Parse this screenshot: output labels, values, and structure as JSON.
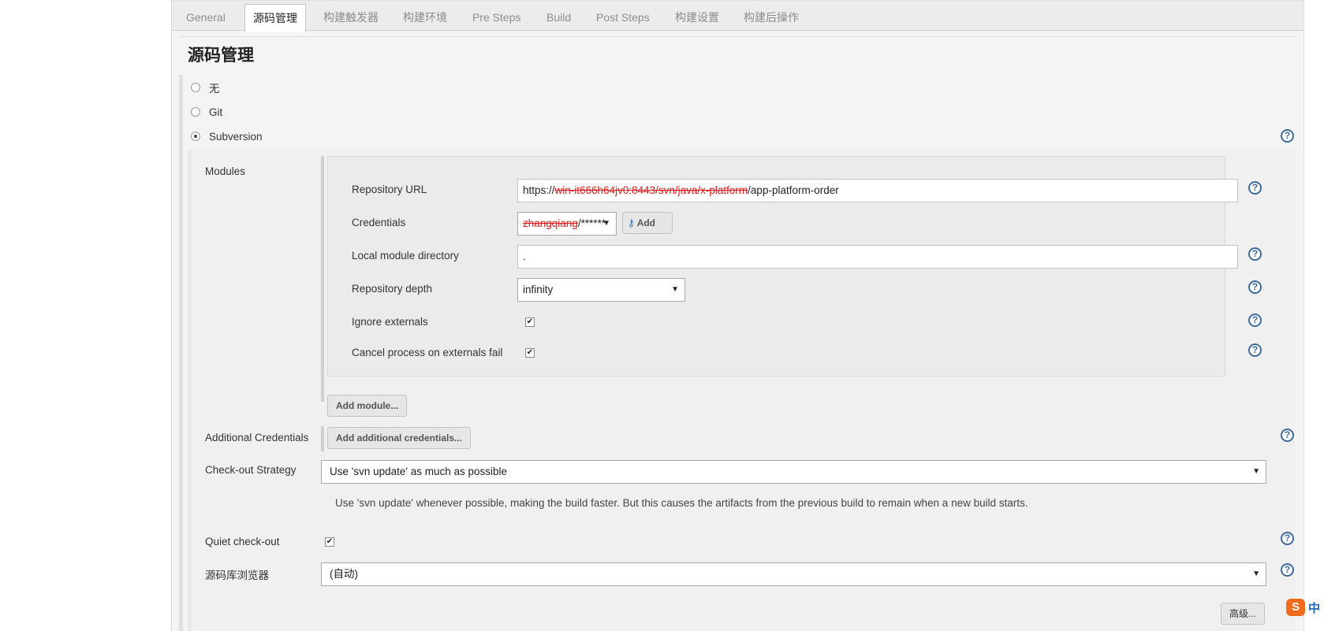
{
  "tabs": [
    {
      "label": "General"
    },
    {
      "label": "源码管理"
    },
    {
      "label": "构建触发器"
    },
    {
      "label": "构建环境"
    },
    {
      "label": "Pre Steps"
    },
    {
      "label": "Build"
    },
    {
      "label": "Post Steps"
    },
    {
      "label": "构建设置"
    },
    {
      "label": "构建后操作"
    }
  ],
  "active_tab": "源码管理",
  "section_title": "源码管理",
  "scm_options": [
    {
      "label": "无",
      "checked": false
    },
    {
      "label": "Git",
      "checked": false
    },
    {
      "label": "Subversion",
      "checked": true
    }
  ],
  "modules": {
    "label": "Modules",
    "repository_url": {
      "label": "Repository URL",
      "value_prefix": "https://",
      "value_redacted": "win-it666h64jv0:8443/svn/java/x-platform",
      "value_suffix": "/app-platform-order"
    },
    "credentials": {
      "label": "Credentials",
      "value_redacted": "zhangqiang",
      "value_suffix": "/******",
      "add_button": "Add"
    },
    "local_module_directory": {
      "label": "Local module directory",
      "value": "."
    },
    "repository_depth": {
      "label": "Repository depth",
      "value": "infinity"
    },
    "ignore_externals": {
      "label": "Ignore externals",
      "checked": true
    },
    "cancel_on_externals_fail": {
      "label": "Cancel process on externals fail",
      "checked": true
    },
    "add_module_button": "Add module..."
  },
  "additional_credentials": {
    "label": "Additional Credentials",
    "button": "Add additional credentials..."
  },
  "checkout_strategy": {
    "label": "Check-out Strategy",
    "value": "Use 'svn update' as much as possible",
    "description": "Use 'svn update' whenever possible, making the build faster. But this causes the artifacts from the previous build to remain when a new build starts."
  },
  "quiet_checkout": {
    "label": "Quiet check-out",
    "checked": true
  },
  "repo_browser": {
    "label": "源码库浏览器",
    "value": "(自动)"
  },
  "advanced_button": "高级...",
  "ime": {
    "logo": "S",
    "mode": "中"
  },
  "colors": {
    "help": "#3e6a9c",
    "redaction": "#e11a1a",
    "ime_logo": "#f26a1b"
  }
}
